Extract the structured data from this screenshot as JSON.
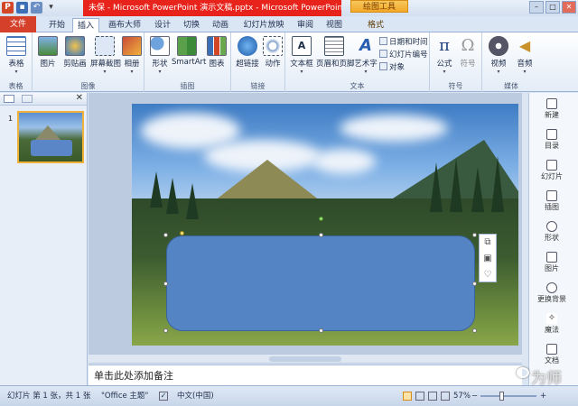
{
  "title": {
    "left_text": "未保 - Microsoft PowerPoint  演示文稿.pptx  -  Microsoft PowerPoint(产品激活...",
    "right_text": "",
    "context_tab": "绘图工具"
  },
  "tabs": [
    {
      "label": "文件"
    },
    {
      "label": "开始"
    },
    {
      "label": "插入"
    },
    {
      "label": "画布大师"
    },
    {
      "label": "设计"
    },
    {
      "label": "切换"
    },
    {
      "label": "动画"
    },
    {
      "label": "幻灯片放映"
    },
    {
      "label": "审阅"
    },
    {
      "label": "视图"
    },
    {
      "label": "格式"
    }
  ],
  "ribbon": {
    "groups": {
      "table": "表格",
      "image": "图像",
      "illustration": "插图",
      "link": "链接",
      "text": "文本",
      "symbol": "符号",
      "media": "媒体"
    },
    "buttons": {
      "table": "表格",
      "picture": "图片",
      "clipart": "剪贴画",
      "screenshot": "屏幕截图",
      "album": "相册",
      "shapes": "形状",
      "smartart": "SmartArt",
      "chart": "图表",
      "hyperlink": "超链接",
      "action": "动作",
      "textbox": "文本框",
      "headerfooter": "页眉和页脚",
      "wordart": "艺术字",
      "datetime": "日期和时间",
      "slidenum": "幻灯片编号",
      "object": "对象",
      "equation": "公式",
      "symbol": "符号",
      "video": "视频",
      "audio": "音频"
    }
  },
  "slides_panel": {
    "slide_number": "1"
  },
  "notes_placeholder": "单击此处添加备注",
  "right_panel": [
    {
      "label": "新建"
    },
    {
      "label": "目录"
    },
    {
      "label": "幻灯片"
    },
    {
      "label": "插图"
    },
    {
      "label": "形状"
    },
    {
      "label": "图片"
    },
    {
      "label": "更换背景"
    },
    {
      "label": "魔法"
    },
    {
      "label": "文档"
    }
  ],
  "status": {
    "slide_info": "幻灯片 第 1 张，共 1 张",
    "theme": "\"Office 主题\"",
    "language": "中文(中国)",
    "zoom": "57%"
  },
  "watermark": "为师"
}
